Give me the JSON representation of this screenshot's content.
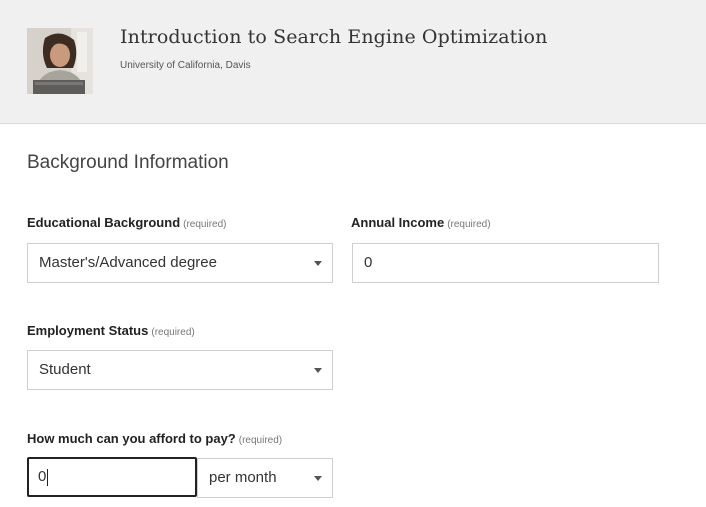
{
  "course": {
    "title": "Introduction to Search Engine Optimization",
    "organization": "University of California, Davis",
    "thumbnail_icon": "instructor-photo"
  },
  "section": {
    "title": "Background Information"
  },
  "education": {
    "label": "Educational Background",
    "required": "(required)",
    "value": "Master's/Advanced degree"
  },
  "income": {
    "label": "Annual Income",
    "required": "(required)",
    "value": "0"
  },
  "employment": {
    "label": "Employment Status",
    "required": "(required)",
    "value": "Student"
  },
  "afford": {
    "label": "How much can you afford to pay?",
    "required": "(required)",
    "amount": "0",
    "period": "per month"
  },
  "colors": {
    "header_bg": "#f0f0f0",
    "focus_border": "#222222"
  }
}
